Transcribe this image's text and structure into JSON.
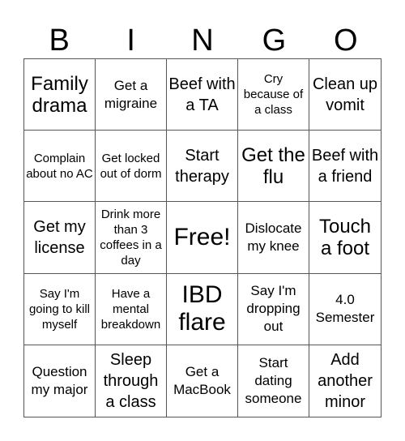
{
  "header": {
    "letters": [
      "B",
      "I",
      "N",
      "G",
      "O"
    ]
  },
  "cells": [
    {
      "text": "Family drama",
      "size": "s-lg"
    },
    {
      "text": "Get a migraine",
      "size": "s-sm"
    },
    {
      "text": "Beef with a TA",
      "size": "s-md"
    },
    {
      "text": "Cry because of a class",
      "size": "s-xs"
    },
    {
      "text": "Clean up vomit",
      "size": "s-md"
    },
    {
      "text": "Complain about no AC",
      "size": "s-xs"
    },
    {
      "text": "Get locked out of dorm",
      "size": "s-xs"
    },
    {
      "text": "Start therapy",
      "size": "s-md"
    },
    {
      "text": "Get the flu",
      "size": "s-lg"
    },
    {
      "text": "Beef with a friend",
      "size": "s-md"
    },
    {
      "text": "Get my license",
      "size": "s-md"
    },
    {
      "text": "Drink more than 3 coffees in a day",
      "size": "s-xs"
    },
    {
      "text": "Free!",
      "size": "s-xl"
    },
    {
      "text": "Dislocate my knee",
      "size": "s-sm"
    },
    {
      "text": "Touch a foot",
      "size": "s-lg"
    },
    {
      "text": "Say I'm going to kill myself",
      "size": "s-xs"
    },
    {
      "text": "Have a mental breakdown",
      "size": "s-xs"
    },
    {
      "text": "IBD flare",
      "size": "s-xl"
    },
    {
      "text": "Say I'm dropping out",
      "size": "s-sm"
    },
    {
      "text": "4.0 Semester",
      "size": "s-sm"
    },
    {
      "text": "Question my major",
      "size": "s-sm"
    },
    {
      "text": "Sleep through a class",
      "size": "s-md"
    },
    {
      "text": "Get a MacBook",
      "size": "s-sm"
    },
    {
      "text": "Start dating someone",
      "size": "s-sm"
    },
    {
      "text": "Add another minor",
      "size": "s-md"
    }
  ]
}
